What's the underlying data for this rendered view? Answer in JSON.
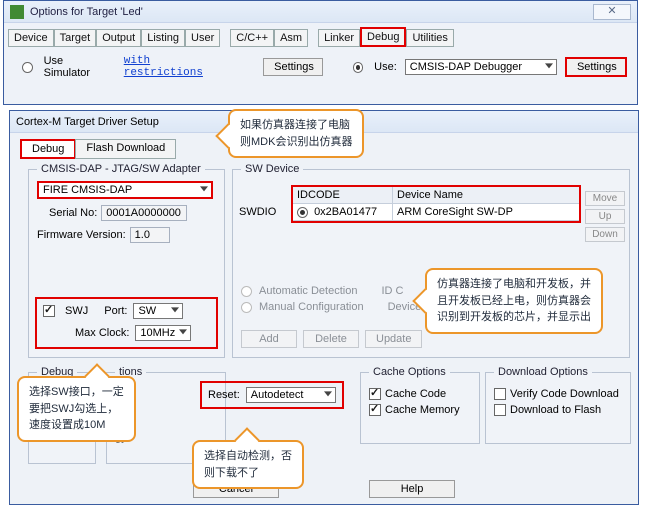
{
  "outer": {
    "title": "Options for Target 'Led'",
    "close_glyph": "✕",
    "tabs": [
      "Device",
      "Target",
      "Output",
      "Listing",
      "User",
      "C/C++",
      "Asm",
      "Linker",
      "Debug",
      "Utilities"
    ],
    "active_tab": "Debug",
    "use_simulator_label": "Use Simulator",
    "with_restrictions": "with restrictions",
    "settings_label": "Settings",
    "use_label": "Use:",
    "debugger_selected": "CMSIS-DAP Debugger",
    "settings_label_right": "Settings"
  },
  "inner": {
    "title": "Cortex-M Target Driver Setup",
    "tabs": [
      "Debug",
      "Flash Download"
    ]
  },
  "adapter": {
    "legend": "CMSIS-DAP - JTAG/SW Adapter",
    "device_selected": "FIRE CMSIS-DAP",
    "serial_label": "Serial No:",
    "serial_value": "0001A0000000",
    "fw_label": "Firmware Version:",
    "fw_value": "1.0",
    "swj_label": "SWJ",
    "port_label": "Port:",
    "port_value": "SW",
    "clock_label": "Max Clock:",
    "clock_value": "10MHz"
  },
  "swdev": {
    "legend": "SW Device",
    "swdio": "SWDIO",
    "col_idcode": "IDCODE",
    "col_devname": "Device Name",
    "row_idcode": "0x2BA01477",
    "row_devname": "ARM CoreSight SW-DP",
    "move": "Move",
    "up": "Up",
    "down": "Down",
    "auto_detect": "Automatic Detection",
    "manual_conf": "Manual Configuration",
    "idcode_lbl": "ID C",
    "devname_lbl": "Device N",
    "add": "Add",
    "delete": "Delete",
    "update": "Update"
  },
  "debug": {
    "legend": "Debug"
  },
  "options_frag": {
    "legend_suffix": "tions",
    "ct": "ct"
  },
  "reset": {
    "label": "Reset:",
    "value": "Autodetect"
  },
  "cache": {
    "legend": "Cache Options",
    "code": "Cache Code",
    "memory": "Cache Memory"
  },
  "download": {
    "legend": "Download Options",
    "verify": "Verify Code Download",
    "flash": "Download to Flash"
  },
  "buttons": {
    "cancel": "Cancel",
    "help": "Help"
  },
  "callouts": {
    "c1a": "如果仿真器连接了电脑",
    "c1b": "则MDK会识别出仿真器",
    "c2a": "仿真器连接了电脑和开发板，并",
    "c2b": "且开发板已经上电，则仿真器会",
    "c2c": "识别到开发板的芯片，并显示出",
    "c3a": "选择SW接口，一定",
    "c3b": "要把SWJ勾选上，",
    "c3c": "速度设置成10M",
    "c4a": "选择自动检测，否",
    "c4b": "则下载不了"
  }
}
